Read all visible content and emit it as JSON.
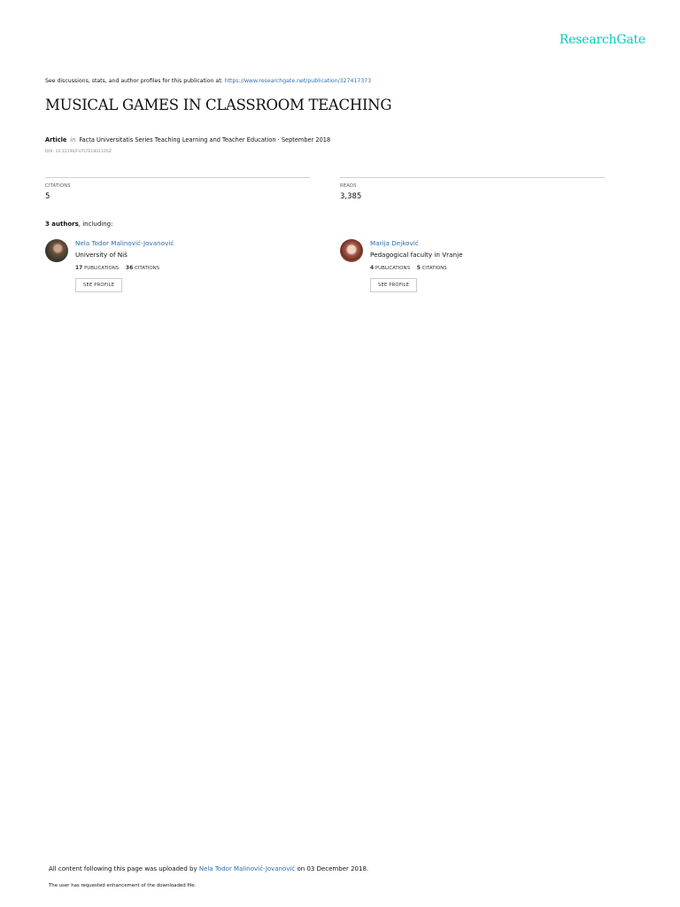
{
  "brand": {
    "logo_text": "ResearchGate",
    "accent_color": "#00ccbb",
    "link_color": "#2c6fb0"
  },
  "header": {
    "note_text": "See discussions, stats, and author profiles for this publication at: ",
    "publication_url": "https://www.researchgate.net/publication/327417373"
  },
  "publication": {
    "title": "MUSICAL GAMES IN CLASSROOM TEACHING",
    "type": "Article",
    "in_label": "in",
    "journal_and_date": "Facta Universitatis Series Teaching Learning and Teacher Education · September 2018",
    "doi": "DOI: 10.22190/FUTLTE1801105Z"
  },
  "stats": {
    "citations_label": "CITATIONS",
    "citations_value": "5",
    "reads_label": "READS",
    "reads_value": "3,385"
  },
  "authors_section": {
    "count_text": "3 authors",
    "suffix_text": ", including:"
  },
  "authors": [
    {
      "name": "Nela Todor Malinović-Jovanović",
      "institution": "University of Niš",
      "publications_count": "17",
      "publications_label": "PUBLICATIONS",
      "citations_count": "36",
      "citations_label": "CITATIONS",
      "button_label": "SEE PROFILE"
    },
    {
      "name": "Marija Dejković",
      "institution": "Pedagogical faculty in Vranje",
      "publications_count": "4",
      "publications_label": "PUBLICATIONS",
      "citations_count": "5",
      "citations_label": "CITATIONS",
      "button_label": "SEE PROFILE"
    }
  ],
  "footer": {
    "uploaded_prefix": "All content following this page was uploaded by ",
    "uploader_name": "Nela Todor Malinović-Jovanović",
    "uploaded_suffix": " on 03 December 2018.",
    "enhancement_note": "The user has requested enhancement of the downloaded file."
  }
}
